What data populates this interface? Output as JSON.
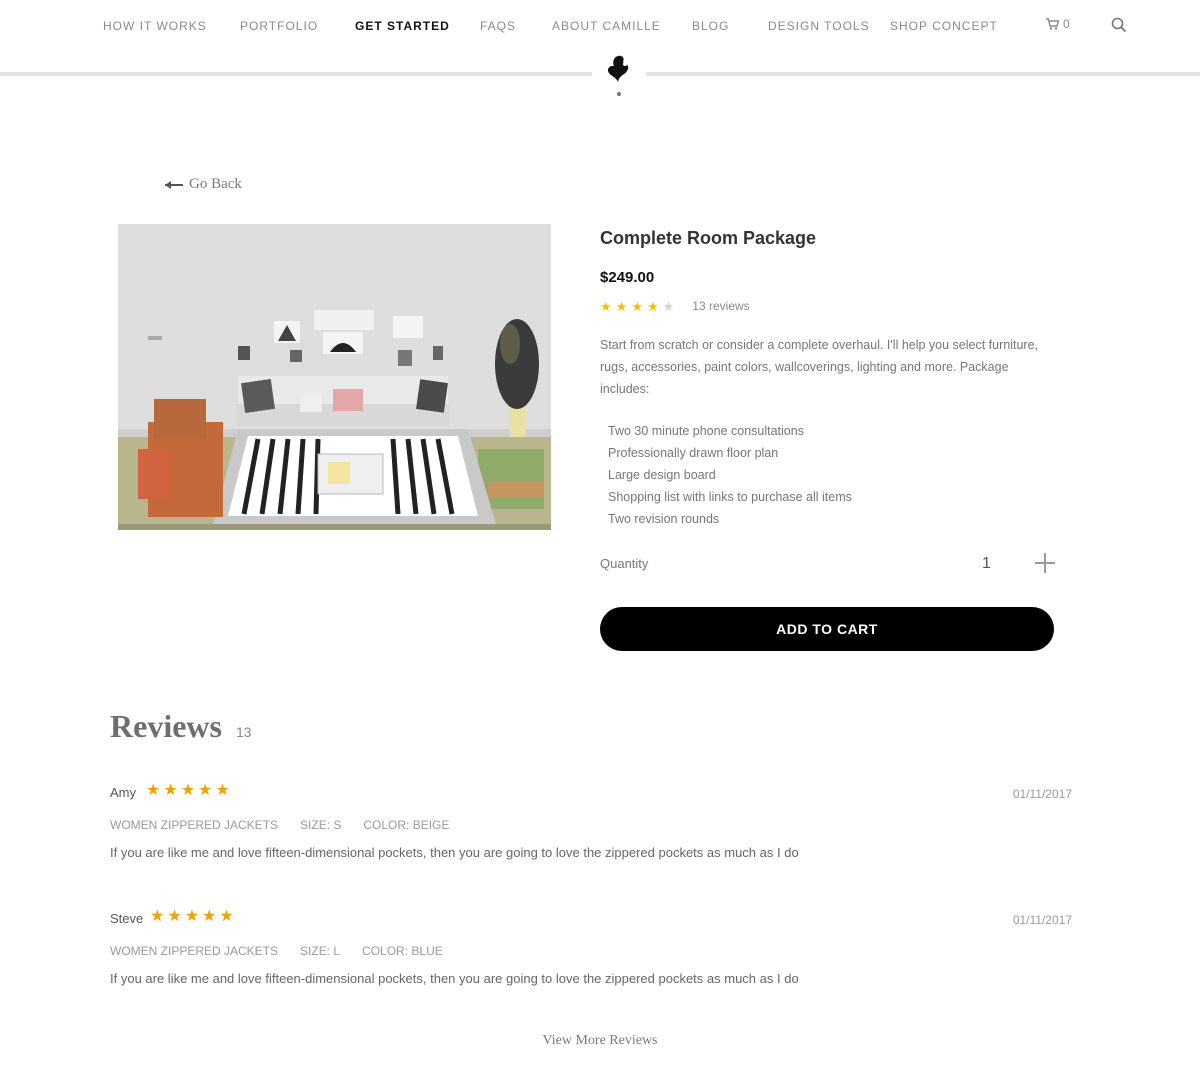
{
  "nav": {
    "items": [
      {
        "label": "HOW IT WORKS"
      },
      {
        "label": "PORTFOLIO"
      },
      {
        "label": "GET STARTED"
      },
      {
        "label": "FAQS"
      },
      {
        "label": "ABOUT CAMILLE"
      },
      {
        "label": "BLOG"
      },
      {
        "label": "DESIGN TOOLS"
      },
      {
        "label": "SHOP CONCEPT"
      }
    ],
    "active": "GET STARTED",
    "cart_count": "0",
    "cart_icon": "cart-icon",
    "search_icon": "search-icon"
  },
  "back_label": "Go Back",
  "product": {
    "title": "Complete Room Package",
    "price": "$249.00",
    "rating": 4,
    "rating_max": 5,
    "review_count_label": "13 reviews",
    "description": "Start from scratch or consider a complete overhaul. I'll help you select furniture, rugs, accessories, paint colors, wallcoverings, lighting and more. Package includes:",
    "features": [
      "Two 30 minute phone consultations",
      "Professionally drawn floor plan",
      "Large design board",
      "Shopping list with links to purchase all items",
      "Two revision rounds"
    ],
    "quantity_label": "Quantity",
    "quantity": "1",
    "add_to_cart_label": "ADD TO CART"
  },
  "reviews": {
    "title": "Reviews",
    "total": "13",
    "items": [
      {
        "name": "Amy",
        "stars": 5,
        "date": "01/11/2017",
        "meta": [
          "WOMEN ZIPPERED JACKETS",
          "SIZE: S",
          "COLOR: BEIGE"
        ],
        "text": "If you are like me and love fifteen-dimensional pockets, then you are going to love the zippered pockets as much as I do"
      },
      {
        "name": "Steve",
        "stars": 5,
        "date": "01/11/2017",
        "meta": [
          "WOMEN ZIPPERED JACKETS",
          "SIZE: L",
          "COLOR: BLUE"
        ],
        "text": "If you are like me and love fifteen-dimensional pockets, then you are going to love the zippered pockets as much as I do"
      }
    ],
    "view_more_label": "View More Reviews"
  },
  "colors": {
    "accent": "#000000",
    "star": "#f2c200",
    "review_star": "#f2a200"
  }
}
